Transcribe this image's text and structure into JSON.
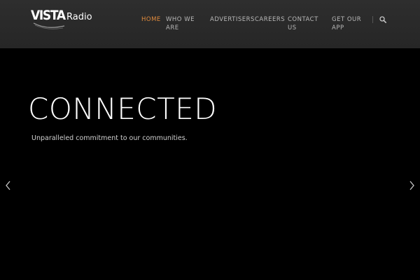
{
  "header": {
    "logo": {
      "brand": "VISTA",
      "suffix": "Radio"
    },
    "nav": {
      "items": [
        {
          "label": "HOME",
          "active": true
        },
        {
          "label": "WHO WE ARE",
          "active": false
        },
        {
          "label": "ADVERTISERS",
          "active": false
        },
        {
          "label": "CAREERS",
          "active": false
        },
        {
          "label": "CONTACT US",
          "active": false
        },
        {
          "label": "GET OUR APP",
          "active": false
        }
      ]
    },
    "search_icon": "search-icon"
  },
  "hero": {
    "title": "CONNECTED",
    "subtitle": "Unparalleled commitment to our communities.",
    "prev_icon": "chevron-left-icon",
    "next_icon": "chevron-right-icon"
  },
  "colors": {
    "header_bg": "#2a2a2a",
    "hero_bg": "#000000",
    "accent": "#e08a3c",
    "nav_text": "#b8b8b8"
  }
}
